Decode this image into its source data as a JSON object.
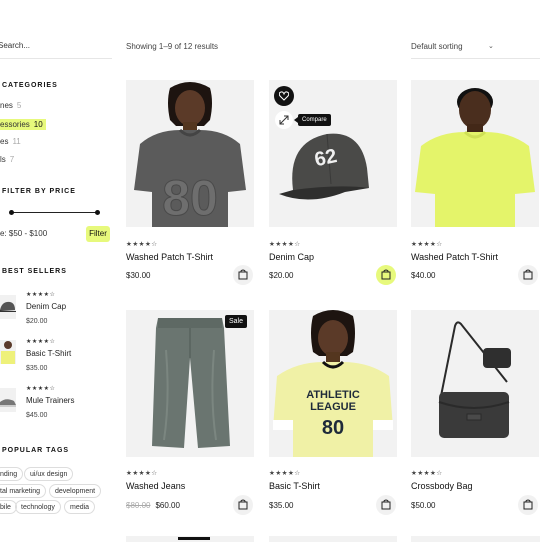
{
  "search": {
    "placeholder": "Search..."
  },
  "toolbar": {
    "results_text": "Showing 1–9 of 12 results",
    "sort_label": "Default sorting"
  },
  "sidebar": {
    "categories_title": "CATEGORIES",
    "categories": [
      {
        "label": "nes",
        "count": "5",
        "active": false
      },
      {
        "label": "essories",
        "count": "10",
        "active": true
      },
      {
        "label": "es",
        "count": "11",
        "active": false
      },
      {
        "label": "ls",
        "count": "7",
        "active": false
      }
    ],
    "price_title": "FILTER BY PRICE",
    "price_text": "e: $50 - $100",
    "filter_label": "Filter",
    "bestsellers_title": "BEST SELLERS",
    "bestsellers": [
      {
        "stars": "★★★★☆",
        "name": "Denim Cap",
        "price": "$20.00"
      },
      {
        "stars": "★★★★☆",
        "name": "Basic T-Shirt",
        "price": "$35.00"
      },
      {
        "stars": "★★★★☆",
        "name": "Mule Trainers",
        "price": "$45.00"
      }
    ],
    "tags_title": "POPULAR TAGS",
    "tags": [
      "nding",
      "ui/ux design",
      "tal marketing",
      "development",
      "bile",
      "technology",
      "media"
    ]
  },
  "products": [
    {
      "name": "Washed Patch T-Shirt",
      "price": "$30.00",
      "old_price": "",
      "stars": "★★★★☆",
      "badge": "",
      "cart_active": false,
      "image": "gray-tshirt"
    },
    {
      "name": "Denim Cap",
      "price": "$20.00",
      "old_price": "",
      "stars": "★★★★☆",
      "badge": "",
      "cart_active": true,
      "image": "cap",
      "tooltip": "Compare"
    },
    {
      "name": "Washed Patch T-Shirt",
      "price": "$40.00",
      "old_price": "",
      "stars": "★★★★☆",
      "badge": "",
      "cart_active": false,
      "image": "lime-tshirt"
    },
    {
      "name": "Washed Jeans",
      "price": "$60.00",
      "old_price": "$80.00",
      "stars": "★★★★☆",
      "badge": "Sale",
      "cart_active": false,
      "image": "jeans"
    },
    {
      "name": "Basic T-Shirt",
      "price": "$35.00",
      "old_price": "",
      "stars": "★★★★☆",
      "badge": "",
      "cart_active": false,
      "image": "athletic-tshirt"
    },
    {
      "name": "Crossbody Bag",
      "price": "$50.00",
      "old_price": "",
      "stars": "★★★★☆",
      "badge": "",
      "cart_active": false,
      "image": "bag"
    }
  ],
  "cap_print": "62",
  "tee_print": {
    "top": "ATHLETIC",
    "mid": "LEAGUE",
    "num": "80"
  },
  "gray_tee_print": "80",
  "colors": {
    "accent": "#e7f97c",
    "dark": "#111111"
  }
}
